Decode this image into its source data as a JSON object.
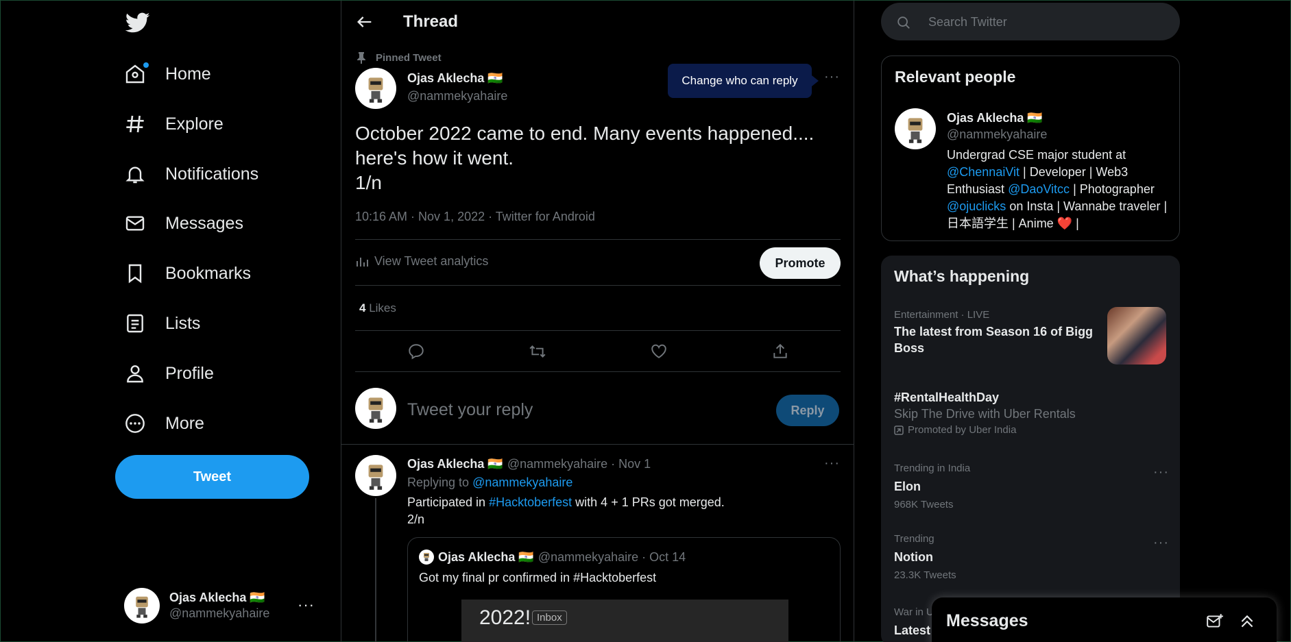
{
  "nav": {
    "items": [
      {
        "label": "Home",
        "icon": "home-icon"
      },
      {
        "label": "Explore",
        "icon": "hashtag-icon"
      },
      {
        "label": "Notifications",
        "icon": "bell-icon"
      },
      {
        "label": "Messages",
        "icon": "envelope-icon"
      },
      {
        "label": "Bookmarks",
        "icon": "bookmark-icon"
      },
      {
        "label": "Lists",
        "icon": "list-icon"
      },
      {
        "label": "Profile",
        "icon": "person-icon"
      },
      {
        "label": "More",
        "icon": "more-circle-icon"
      }
    ],
    "tweet_button": "Tweet",
    "account": {
      "name": "Ojas Aklecha 🇮🇳",
      "handle": "@nammekyahaire",
      "more": "···"
    }
  },
  "main": {
    "title": "Thread",
    "pinned": "Pinned Tweet",
    "author": {
      "name": "Ojas Aklecha 🇮🇳",
      "handle": "@nammekyahaire"
    },
    "tooltip": "Change who can reply",
    "more": "···",
    "text": "October 2022 came to end. Many events happened.... here's how it went.\n1/n",
    "meta": "10:16 AM · Nov 1, 2022 · Twitter for Android",
    "analytics": "View Tweet analytics",
    "promote": "Promote",
    "likes_count": "4",
    "likes_label": "Likes",
    "reply_placeholder": "Tweet your reply",
    "reply_button": "Reply",
    "reply": {
      "name": "Ojas Aklecha 🇮🇳",
      "handle_time": "@nammekyahaire · Nov 1",
      "replying_prefix": "Replying to",
      "replying_to": "@nammekyahaire",
      "text_pre": "Participated in",
      "hashtag": "#Hacktoberfest",
      "text_post": "with 4 + 1 PRs got merged.",
      "text_line2": "2/n",
      "more": "···",
      "quote": {
        "name": "Ojas Aklecha 🇮🇳",
        "handle_time": "@nammekyahaire · Oct 14",
        "text": "Got my final pr confirmed in #Hacktoberfest",
        "image_year": "2022!",
        "image_badge": "Inbox"
      }
    }
  },
  "right": {
    "search_placeholder": "Search Twitter",
    "relevant": {
      "title": "Relevant people",
      "name": "Ojas Aklecha 🇮🇳",
      "handle": "@nammekyahaire",
      "bio_1": "Undergrad CSE major student at",
      "bio_link1": "@ChennaiVit",
      "bio_2": "| Developer | Web3 Enthusiast",
      "bio_link2": "@DaoVitcc",
      "bio_3": "| Photographer",
      "bio_link3": "@ojuclicks",
      "bio_4": "on Insta | Wannabe traveler |日本語学生 | Anime",
      "bio_heart": "❤️",
      "bio_5": "|"
    },
    "happening": {
      "title": "What’s happening",
      "trends": [
        {
          "category": "Entertainment · LIVE",
          "topic": "The latest from Season 16 of Bigg Boss"
        },
        {
          "topic": "#RentalHealthDay",
          "sub": "Skip The Drive with Uber Rentals",
          "promoted": "Promoted by Uber India"
        },
        {
          "category": "Trending in India",
          "topic": "Elon",
          "count": "968K Tweets"
        },
        {
          "category": "Trending",
          "topic": "Notion",
          "count": "23.3K Tweets"
        },
        {
          "category": "War in U",
          "topic": "Latest"
        }
      ],
      "more": "···"
    },
    "messages_drawer": "Messages"
  },
  "colors": {
    "accent": "#1d9bf0",
    "background": "#000000",
    "muted": "#71767b"
  }
}
